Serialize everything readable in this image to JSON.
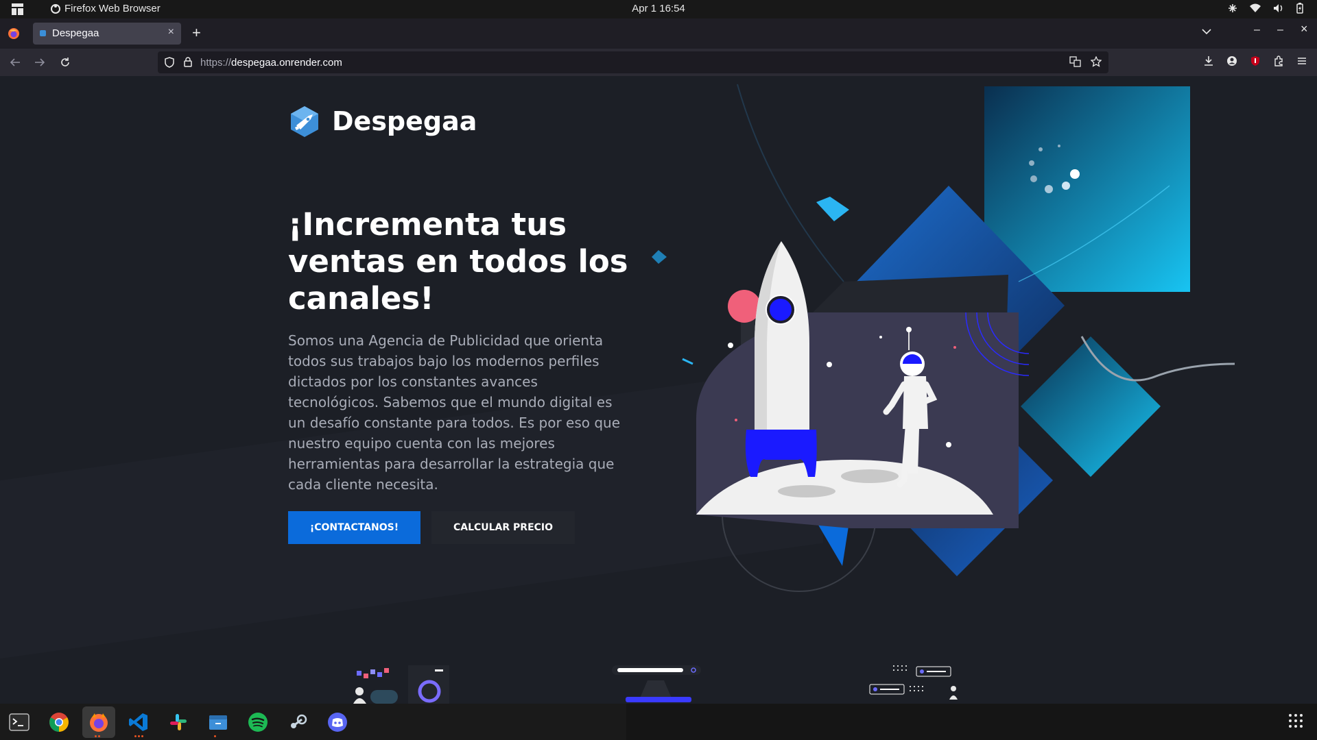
{
  "system": {
    "app_title": "Firefox Web Browser",
    "clock": "Apr 1  16:54",
    "tray_icons": [
      "network-settings-icon",
      "wifi-icon",
      "volume-icon",
      "battery-icon"
    ]
  },
  "browser": {
    "tab": {
      "title": "Despegaa",
      "close_label": "×"
    },
    "new_tab_label": "+",
    "url_scheme": "https://",
    "url_host": "despegaa.onrender.com",
    "window_controls": {
      "minimize": "–",
      "maximize": "–",
      "close": "×"
    }
  },
  "site": {
    "brand_name": "Despegaa",
    "headline": "¡Incrementa tus ventas en todos los canales!",
    "description": "Somos una Agencia de Publicidad que orienta todos sus trabajos bajo los modernos perfiles dictados por los constantes avances tecnológicos. Sabemos que el mundo digital es un desafío constante para todos. Es por eso que nuestro equipo cuenta con las mejores herramientas para desarrollar la estrategia que cada cliente necesita.",
    "cta_primary": "¡CONTACTANOS!",
    "cta_secondary": "CALCULAR PRECIO",
    "colors": {
      "accent": "#0b6bdb",
      "background": "#1c1f26",
      "rocket_blue": "#1a1aff"
    }
  },
  "dock": {
    "apps": [
      "terminal-icon",
      "chrome-icon",
      "firefox-icon",
      "vscode-icon",
      "slack-icon",
      "files-icon",
      "spotify-icon",
      "steam-icon",
      "discord-icon"
    ],
    "active_app": "firefox-icon"
  }
}
